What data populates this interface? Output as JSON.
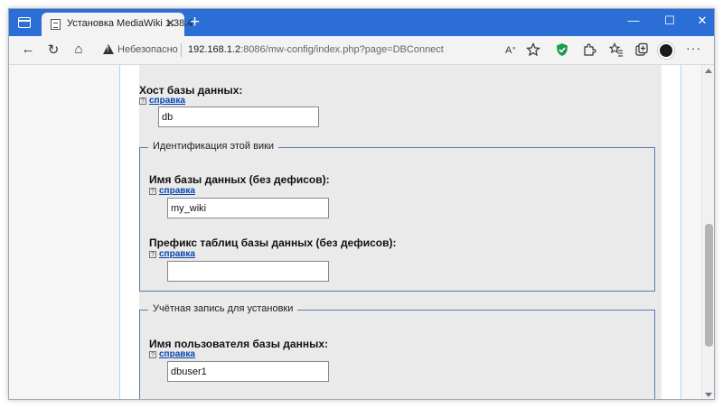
{
  "browser": {
    "tab_title": "Установка MediaWiki 1.38.4",
    "tab_close": "✕",
    "new_tab": "+",
    "security_label": "Небезопасно",
    "url_host": "192.168.1.2",
    "url_rest": ":8086/mw-config/index.php?page=DBConnect",
    "window_controls": {
      "minimize": "—",
      "maximize": "☐",
      "close": "✕"
    },
    "accent_color": "#2b6fd6"
  },
  "form": {
    "help_text": "справка",
    "db_host": {
      "label": "Хост базы данных:",
      "value": "db"
    },
    "wiki_identification": {
      "legend": "Идентификация этой вики",
      "db_name": {
        "label": "Имя базы данных (без дефисов):",
        "value": "my_wiki"
      },
      "table_prefix": {
        "label": "Префикс таблиц базы данных (без дефисов):",
        "value": ""
      }
    },
    "install_account": {
      "legend": "Учётная запись для установки",
      "db_user": {
        "label": "Имя пользователя базы данных:",
        "value": "dbuser1"
      }
    }
  }
}
